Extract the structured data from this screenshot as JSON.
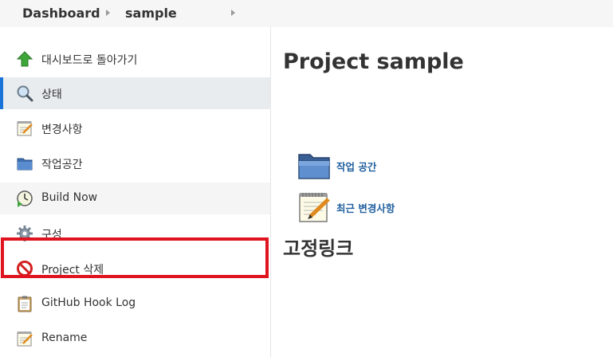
{
  "breadcrumb": {
    "items": [
      {
        "label": "Dashboard"
      },
      {
        "label": "sample"
      }
    ]
  },
  "sidebar": {
    "items": [
      {
        "label": "대시보드로 돌아가기",
        "icon": "up-arrow-icon"
      },
      {
        "label": "상태",
        "icon": "search-icon",
        "active": true
      },
      {
        "label": "변경사항",
        "icon": "notepad-icon"
      },
      {
        "label": "작업공간",
        "icon": "folder-icon"
      },
      {
        "label": "Build Now",
        "icon": "clock-icon"
      },
      {
        "label": "구성",
        "icon": "gear-icon"
      },
      {
        "label": "Project 삭제",
        "icon": "no-entry-icon"
      },
      {
        "label": "GitHub Hook Log",
        "icon": "clipboard-icon"
      },
      {
        "label": "Rename",
        "icon": "notepad-icon"
      }
    ]
  },
  "main": {
    "title": "Project sample",
    "links": [
      {
        "label": "작업 공간",
        "icon": "folder-icon"
      },
      {
        "label": "최근 변경사항",
        "icon": "notepad-icon"
      }
    ],
    "permalinks_title": "고정링크"
  },
  "colors": {
    "accent": "#1a73d9",
    "highlight": "#e0141e",
    "link": "#1f5f9e"
  }
}
